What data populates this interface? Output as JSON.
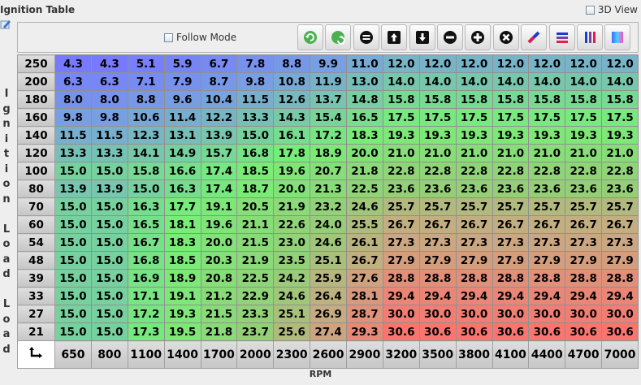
{
  "title": "Ignition Table",
  "view3d_label": "3D View",
  "follow_mode_label": "Follow Mode",
  "x_axis_title": "RPM",
  "y_axis_title": "Ignition Load Load",
  "toolbar_icons": [
    "increment-icon",
    "decrement-icon",
    "set-value-icon",
    "shift-up-icon",
    "shift-down-icon",
    "subtract-icon",
    "add-icon",
    "multiply-icon",
    "interpolate-icon",
    "horizontal-interpolate-icon",
    "vertical-interpolate-icon",
    "color-scale-icon"
  ],
  "rpm": [
    "650",
    "800",
    "1100",
    "1400",
    "1700",
    "2000",
    "2300",
    "2600",
    "2900",
    "3200",
    "3500",
    "3800",
    "4100",
    "4400",
    "4700",
    "7000"
  ],
  "load": [
    "250",
    "200",
    "180",
    "160",
    "140",
    "120",
    "100",
    "80",
    "70",
    "60",
    "54",
    "48",
    "39",
    "33",
    "27",
    "21"
  ],
  "values": [
    [
      "4.3",
      "4.3",
      "5.1",
      "5.9",
      "6.7",
      "7.8",
      "8.8",
      "9.9",
      "11.0",
      "12.0",
      "12.0",
      "12.0",
      "12.0",
      "12.0",
      "12.0",
      "12.0"
    ],
    [
      "6.3",
      "6.3",
      "7.1",
      "7.9",
      "8.7",
      "9.8",
      "10.8",
      "11.9",
      "13.0",
      "14.0",
      "14.0",
      "14.0",
      "14.0",
      "14.0",
      "14.0",
      "14.0"
    ],
    [
      "8.0",
      "8.0",
      "8.8",
      "9.6",
      "10.4",
      "11.5",
      "12.6",
      "13.7",
      "14.8",
      "15.8",
      "15.8",
      "15.8",
      "15.8",
      "15.8",
      "15.8",
      "15.8"
    ],
    [
      "9.8",
      "9.8",
      "10.6",
      "11.4",
      "12.2",
      "13.3",
      "14.3",
      "15.4",
      "16.5",
      "17.5",
      "17.5",
      "17.5",
      "17.5",
      "17.5",
      "17.5",
      "17.5"
    ],
    [
      "11.5",
      "11.5",
      "12.3",
      "13.1",
      "13.9",
      "15.0",
      "16.1",
      "17.2",
      "18.3",
      "19.3",
      "19.3",
      "19.3",
      "19.3",
      "19.3",
      "19.3",
      "19.3"
    ],
    [
      "13.3",
      "13.3",
      "14.1",
      "14.9",
      "15.7",
      "16.8",
      "17.8",
      "18.9",
      "20.0",
      "21.0",
      "21.0",
      "21.0",
      "21.0",
      "21.0",
      "21.0",
      "21.0"
    ],
    [
      "15.0",
      "15.0",
      "15.8",
      "16.6",
      "17.4",
      "18.5",
      "19.6",
      "20.7",
      "21.8",
      "22.8",
      "22.8",
      "22.8",
      "22.8",
      "22.8",
      "22.8",
      "22.8"
    ],
    [
      "13.9",
      "13.9",
      "15.0",
      "16.3",
      "17.4",
      "18.7",
      "20.0",
      "21.3",
      "22.5",
      "23.6",
      "23.6",
      "23.6",
      "23.6",
      "23.6",
      "23.6",
      "23.6"
    ],
    [
      "15.0",
      "15.0",
      "16.3",
      "17.7",
      "19.1",
      "20.5",
      "21.9",
      "23.2",
      "24.6",
      "25.7",
      "25.7",
      "25.7",
      "25.7",
      "25.7",
      "25.7",
      "25.7"
    ],
    [
      "15.0",
      "15.0",
      "16.5",
      "18.1",
      "19.6",
      "21.1",
      "22.6",
      "24.0",
      "25.5",
      "26.7",
      "26.7",
      "26.7",
      "26.7",
      "26.7",
      "26.7",
      "26.7"
    ],
    [
      "15.0",
      "15.0",
      "16.7",
      "18.3",
      "20.0",
      "21.5",
      "23.0",
      "24.6",
      "26.1",
      "27.3",
      "27.3",
      "27.3",
      "27.3",
      "27.3",
      "27.3",
      "27.3"
    ],
    [
      "15.0",
      "15.0",
      "16.8",
      "18.5",
      "20.3",
      "21.9",
      "23.5",
      "25.1",
      "26.7",
      "27.9",
      "27.9",
      "27.9",
      "27.9",
      "27.9",
      "27.9",
      "27.9"
    ],
    [
      "15.0",
      "15.0",
      "16.9",
      "18.9",
      "20.8",
      "22.5",
      "24.2",
      "25.9",
      "27.6",
      "28.8",
      "28.8",
      "28.8",
      "28.8",
      "28.8",
      "28.8",
      "28.8"
    ],
    [
      "15.0",
      "15.0",
      "17.1",
      "19.1",
      "21.2",
      "22.9",
      "24.6",
      "26.4",
      "28.1",
      "29.4",
      "29.4",
      "29.4",
      "29.4",
      "29.4",
      "29.4",
      "29.4"
    ],
    [
      "15.0",
      "15.0",
      "17.2",
      "19.3",
      "21.5",
      "23.3",
      "25.1",
      "26.9",
      "28.7",
      "30.0",
      "30.0",
      "30.0",
      "30.0",
      "30.0",
      "30.0",
      "30.0"
    ],
    [
      "15.0",
      "15.0",
      "17.3",
      "19.5",
      "21.8",
      "23.7",
      "25.6",
      "27.4",
      "29.3",
      "30.6",
      "30.6",
      "30.6",
      "30.6",
      "30.6",
      "30.6",
      "30.6"
    ]
  ]
}
